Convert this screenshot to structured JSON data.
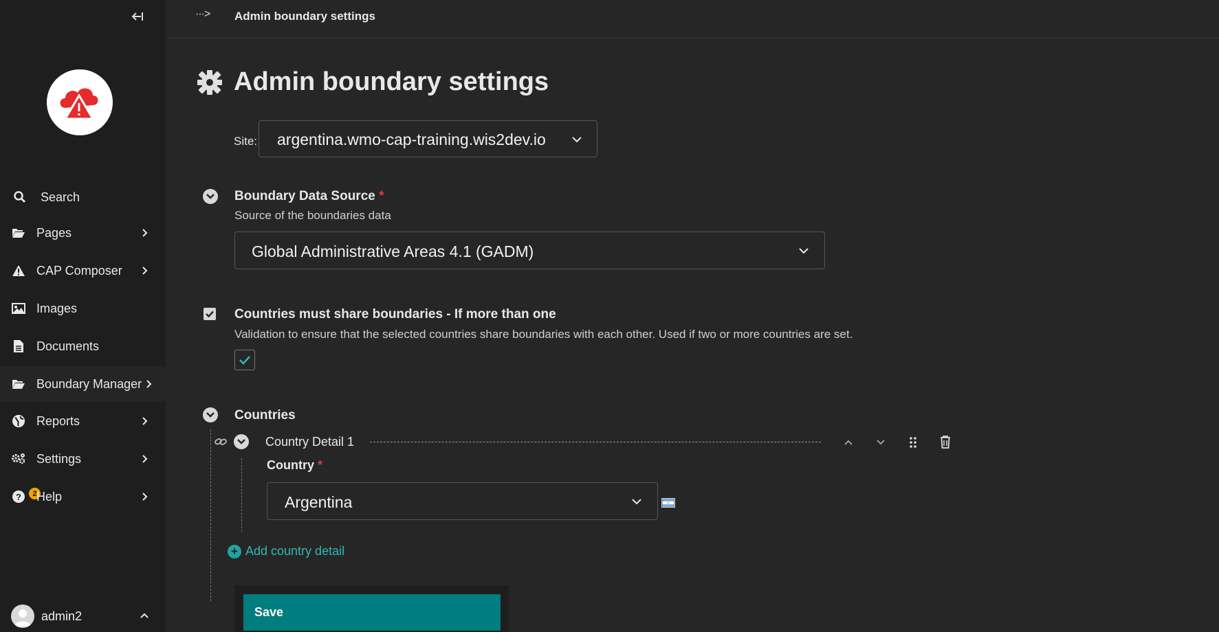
{
  "sidebar": {
    "items": [
      {
        "label": "Search",
        "icon": "search-icon"
      },
      {
        "label": "Pages",
        "icon": "folder-open-icon"
      },
      {
        "label": "CAP Composer",
        "icon": "warning-icon"
      },
      {
        "label": "Images",
        "icon": "image-icon"
      },
      {
        "label": "Documents",
        "icon": "document-icon"
      },
      {
        "label": "Boundary Manager",
        "icon": "folder-open-icon"
      },
      {
        "label": "Reports",
        "icon": "globe-icon"
      },
      {
        "label": "Settings",
        "icon": "cogs-icon"
      },
      {
        "label": "Help",
        "icon": "help-icon",
        "badge": "2"
      }
    ],
    "account": {
      "name": "admin2"
    }
  },
  "header": {
    "breadcrumb_toggle": "···>",
    "breadcrumb_title": "Admin boundary settings"
  },
  "main": {
    "title": "Admin boundary settings",
    "site": {
      "label": "Site:",
      "value": "argentina.wmo-cap-training.wis2dev.io"
    },
    "boundary_source": {
      "title": "Boundary Data Source",
      "required_mark": "*",
      "help": "Source of the boundaries data",
      "value": "Global Administrative Areas 4.1 (GADM)"
    },
    "share_boundaries": {
      "title": "Countries must share boundaries - If more than one",
      "help": "Validation to ensure that the selected countries share boundaries with each other. Used if two or more countries are set.",
      "checked": true
    },
    "countries": {
      "title": "Countries",
      "detail_title": "Country Detail 1",
      "country_label": "Country",
      "required_mark": "*",
      "country_value": "Argentina",
      "add_label": "Add country detail"
    },
    "save_label": "Save"
  },
  "colors": {
    "accent": "#007d7e",
    "link": "#2dbab3",
    "required": "#e0393e",
    "badge": "#f0a500"
  }
}
